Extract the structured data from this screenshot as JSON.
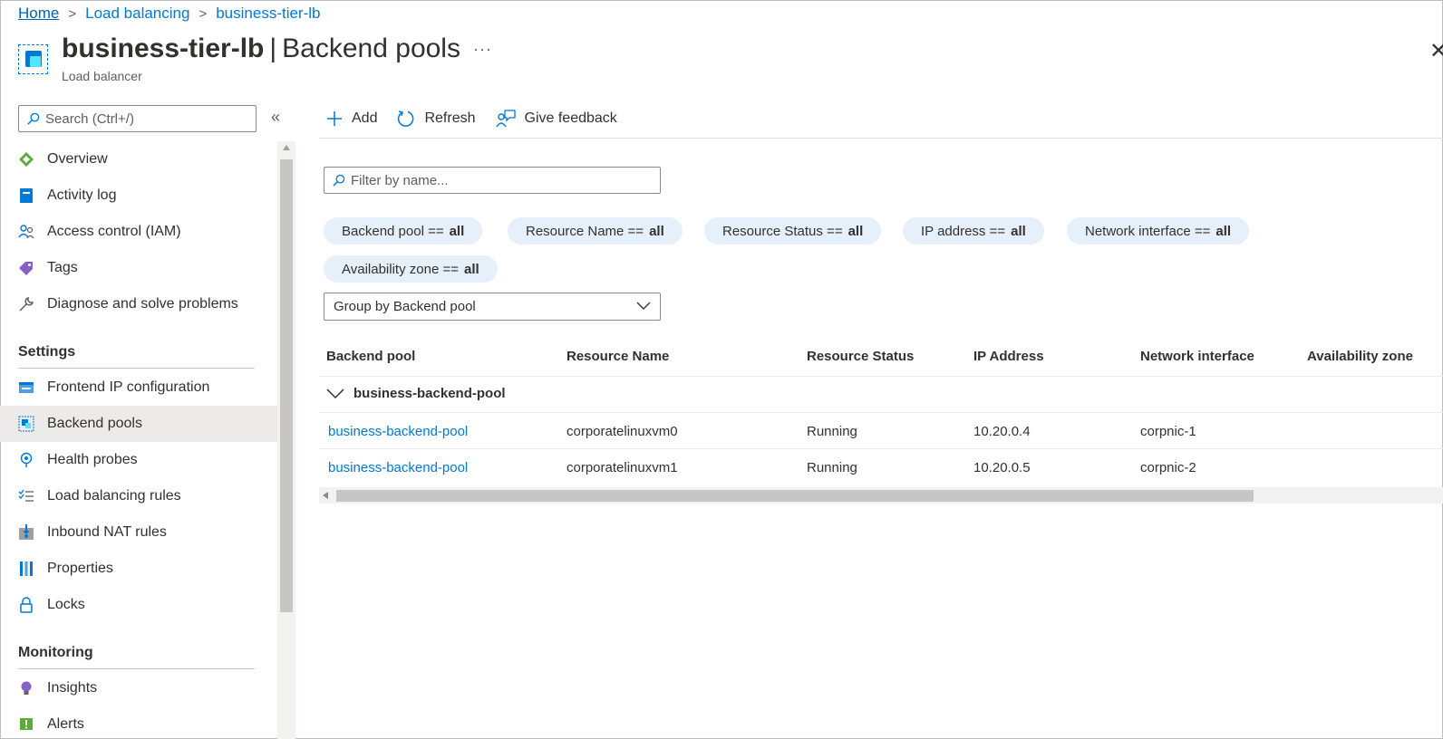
{
  "breadcrumb": {
    "home": "Home",
    "load_balancing": "Load balancing",
    "current": "business-tier-lb"
  },
  "header": {
    "resource_name": "business-tier-lb",
    "separator": "|",
    "page_name": "Backend pools",
    "more": "···",
    "subtitle": "Load balancer",
    "close": "✕"
  },
  "sidebar": {
    "search_placeholder": "Search (Ctrl+/)",
    "collapse": "«",
    "items": [
      {
        "label": "Overview",
        "icon": "overview-icon"
      },
      {
        "label": "Activity log",
        "icon": "activity-log-icon"
      },
      {
        "label": "Access control (IAM)",
        "icon": "access-control-icon"
      },
      {
        "label": "Tags",
        "icon": "tag-icon"
      },
      {
        "label": "Diagnose and solve problems",
        "icon": "wrench-icon"
      }
    ],
    "settings_header": "Settings",
    "settings_items": [
      {
        "label": "Frontend IP configuration",
        "icon": "frontend-ip-icon"
      },
      {
        "label": "Backend pools",
        "icon": "backend-pools-icon",
        "active": true
      },
      {
        "label": "Health probes",
        "icon": "health-probe-icon"
      },
      {
        "label": "Load balancing rules",
        "icon": "rules-list-icon"
      },
      {
        "label": "Inbound NAT rules",
        "icon": "inbound-nat-icon"
      },
      {
        "label": "Properties",
        "icon": "properties-icon"
      },
      {
        "label": "Locks",
        "icon": "lock-icon"
      }
    ],
    "monitoring_header": "Monitoring",
    "monitoring_items": [
      {
        "label": "Insights",
        "icon": "lightbulb-icon"
      },
      {
        "label": "Alerts",
        "icon": "alert-icon"
      }
    ]
  },
  "toolbar": {
    "add": "Add",
    "refresh": "Refresh",
    "feedback": "Give feedback"
  },
  "filter": {
    "placeholder": "Filter by name..."
  },
  "pills": [
    {
      "label": "Backend pool ==",
      "value": "all"
    },
    {
      "label": "Resource Name ==",
      "value": "all"
    },
    {
      "label": "Resource Status ==",
      "value": "all"
    },
    {
      "label": "IP address ==",
      "value": "all"
    },
    {
      "label": "Network interface ==",
      "value": "all"
    },
    {
      "label": "Availability zone ==",
      "value": "all"
    }
  ],
  "group_by": {
    "selected": "Group by Backend pool"
  },
  "table": {
    "columns": [
      "Backend pool",
      "Resource Name",
      "Resource Status",
      "IP Address",
      "Network interface",
      "Availability zone"
    ],
    "group_name": "business-backend-pool",
    "rows": [
      {
        "pool": "business-backend-pool",
        "resource": "corporatelinuxvm0",
        "status": "Running",
        "ip": "10.20.0.4",
        "nic": "corpnic-1",
        "zone": ""
      },
      {
        "pool": "business-backend-pool",
        "resource": "corporatelinuxvm1",
        "status": "Running",
        "ip": "10.20.0.5",
        "nic": "corpnic-2",
        "zone": ""
      }
    ]
  },
  "colors": {
    "accent": "#0078d4",
    "pill_bg": "#e6f0fa",
    "active_nav": "#edebe9"
  }
}
